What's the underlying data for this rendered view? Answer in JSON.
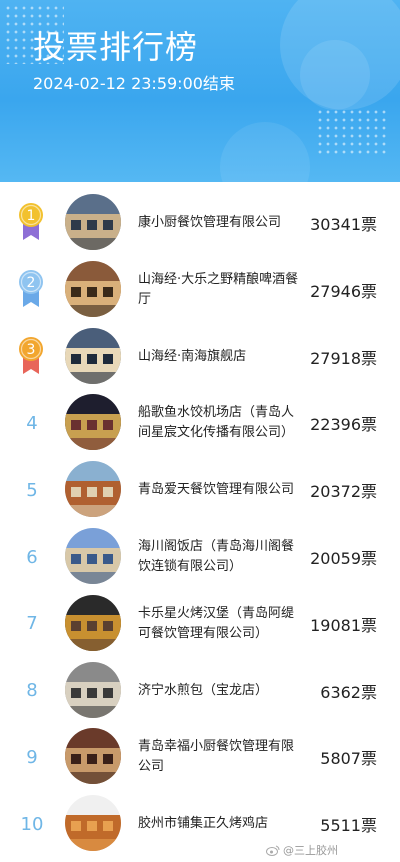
{
  "header": {
    "title": "投票排行榜",
    "subtitle": "2024-02-12 23:59:00结束"
  },
  "colors": {
    "header_blue": "#3aa6ee",
    "rank_number": "#6fb6e6",
    "gold": "#f2c12e",
    "silver": "#8fc4f0",
    "bronze": "#f2a62e",
    "ribbon_purple": "#8e6fd6",
    "ribbon_blue": "#6aa9e8",
    "ribbon_red": "#e8655a"
  },
  "entries": [
    {
      "rank": "1",
      "name": "康小厨餐饮管理有限公司",
      "votes": "30341票",
      "medal": "gold",
      "photo": "restaurant-building-photo"
    },
    {
      "rank": "2",
      "name": "山海经·大乐之野精酿啤酒餐厅",
      "votes": "27946票",
      "medal": "silver",
      "photo": "restaurant-building-photo"
    },
    {
      "rank": "3",
      "name": "山海经·南海旗舰店",
      "votes": "27918票",
      "medal": "bronze",
      "photo": "restaurant-building-photo"
    },
    {
      "rank": "4",
      "name": "船歌鱼水饺机场店（青岛人间星宸文化传播有限公司）",
      "votes": "22396票",
      "photo": "restaurant-building-photo"
    },
    {
      "rank": "5",
      "name": "青岛爱天餐饮管理有限公司",
      "votes": "20372票",
      "photo": "restaurant-building-photo"
    },
    {
      "rank": "6",
      "name": "海川阁饭店（青岛海川阁餐饮连锁有限公司）",
      "votes": "20059票",
      "photo": "restaurant-building-photo"
    },
    {
      "rank": "7",
      "name": "卡乐星火烤汉堡（青岛阿缇可餐饮管理有限公司）",
      "votes": "19081票",
      "photo": "restaurant-building-photo"
    },
    {
      "rank": "8",
      "name": "济宁水煎包（宝龙店）",
      "votes": "6362票",
      "photo": "restaurant-building-photo"
    },
    {
      "rank": "9",
      "name": "青岛幸福小厨餐饮管理有限公司",
      "votes": "5807票",
      "photo": "restaurant-building-photo"
    },
    {
      "rank": "10",
      "name": "胶州市铺集正久烤鸡店",
      "votes": "5511票",
      "photo": "roast-chicken-photo"
    }
  ],
  "watermark": {
    "text": "@三上胶州",
    "icon": "weibo-icon"
  }
}
